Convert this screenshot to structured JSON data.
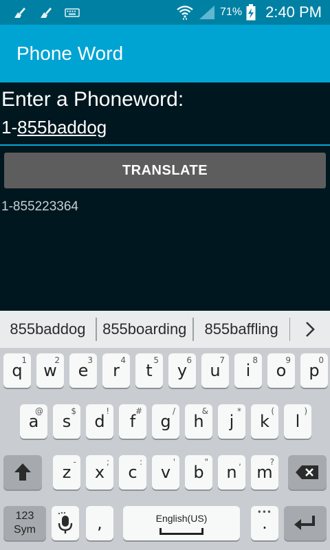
{
  "status_bar": {
    "battery_percent": "71%",
    "time": "2:40 PM",
    "icons": [
      "cleaner-icon",
      "cleaner-icon",
      "keyboard-icon",
      "wifi-icon",
      "signal-icon",
      "battery-charging-icon"
    ]
  },
  "app_bar": {
    "title": "Phone Word"
  },
  "form": {
    "prompt": "Enter a Phoneword:",
    "input_prefix": "1-",
    "input_underlined": "855baddog",
    "translate_label": "TRANSLATE",
    "result": "1-855223364"
  },
  "suggestions": [
    "855baddog",
    "855boarding",
    "855baffling"
  ],
  "keyboard": {
    "row1": [
      {
        "main": "q",
        "sub": "1"
      },
      {
        "main": "w",
        "sub": "2"
      },
      {
        "main": "e",
        "sub": "3"
      },
      {
        "main": "r",
        "sub": "4"
      },
      {
        "main": "t",
        "sub": "5"
      },
      {
        "main": "y",
        "sub": "6"
      },
      {
        "main": "u",
        "sub": "7"
      },
      {
        "main": "i",
        "sub": "8"
      },
      {
        "main": "o",
        "sub": "9"
      },
      {
        "main": "p",
        "sub": "0"
      }
    ],
    "row2": [
      {
        "main": "a",
        "sub": "@"
      },
      {
        "main": "s",
        "sub": "$"
      },
      {
        "main": "d",
        "sub": "!"
      },
      {
        "main": "f",
        "sub": "#"
      },
      {
        "main": "g",
        "sub": "/"
      },
      {
        "main": "h",
        "sub": "&"
      },
      {
        "main": "j",
        "sub": "*"
      },
      {
        "main": "k",
        "sub": "("
      },
      {
        "main": "l",
        "sub": ")"
      }
    ],
    "row3": [
      {
        "main": "z",
        "sub": "-"
      },
      {
        "main": "x",
        "sub": ";"
      },
      {
        "main": "c",
        "sub": ":"
      },
      {
        "main": "v",
        "sub": "'"
      },
      {
        "main": "b",
        "sub": "\""
      },
      {
        "main": "n",
        "sub": ","
      },
      {
        "main": "m",
        "sub": "?"
      }
    ],
    "sym_line1": "123",
    "sym_line2": "Sym",
    "comma": ",",
    "space_language": "English(US)",
    "period": "."
  },
  "colors": {
    "status_bar": "#0081a3",
    "app_bar": "#00a4d3",
    "background": "#00171f",
    "accent_line": "#0aa7d5",
    "button": "#5d5d5d"
  }
}
